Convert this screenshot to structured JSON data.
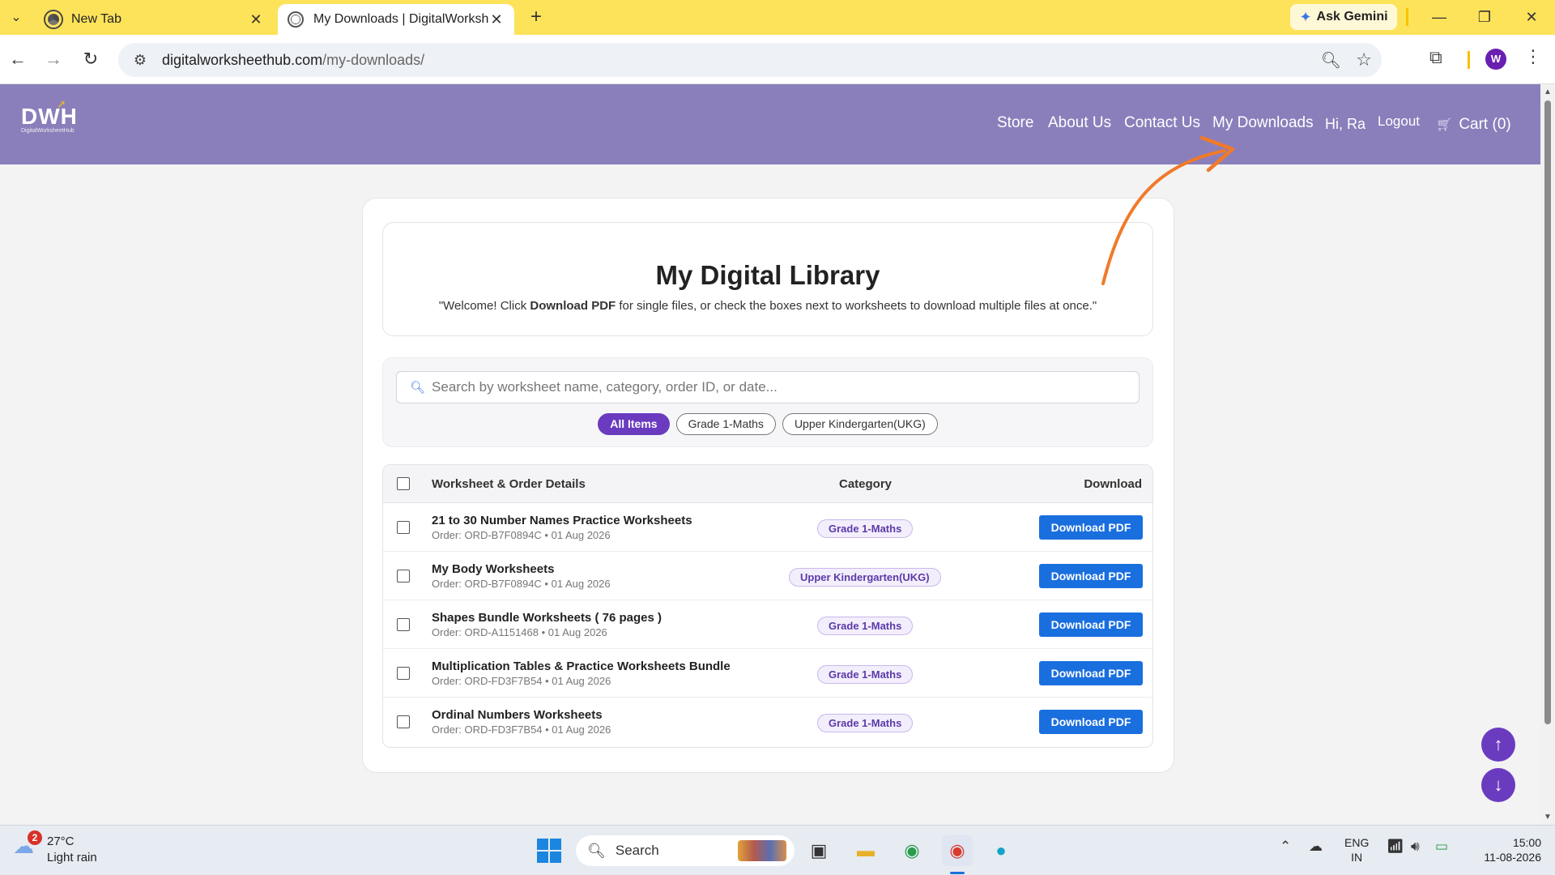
{
  "browser": {
    "tabs": [
      {
        "title": "New Tab",
        "active": false
      },
      {
        "title": "My Downloads | DigitalWorkshe",
        "active": true
      }
    ],
    "ask_gemini": "Ask Gemini",
    "url_domain": "digitalworksheethub.com",
    "url_path": "/my-downloads/",
    "profile_initial": "W"
  },
  "site": {
    "logo": "DWH",
    "logo_sub": "DigitalWorksheetHub",
    "nav": {
      "store": "Store",
      "about": "About Us",
      "contact": "Contact Us",
      "downloads": "My Downloads",
      "greeting": "Hi, Ra",
      "logout": "Logout",
      "cart": "Cart (0)"
    }
  },
  "library": {
    "title": "My Digital Library",
    "welcome_before": "\"Welcome! Click ",
    "welcome_bold": "Download PDF",
    "welcome_after": " for single files, or check the boxes next to worksheets to download multiple files at once.\"",
    "search_placeholder": "Search by worksheet name, category, order ID, or date...",
    "filters": [
      "All Items",
      "Grade 1-Maths",
      "Upper Kindergarten(UKG)"
    ],
    "active_filter": "All Items",
    "columns": {
      "details": "Worksheet & Order Details",
      "category": "Category",
      "download": "Download"
    },
    "download_label": "Download PDF",
    "rows": [
      {
        "name": "21 to 30 Number Names Practice Worksheets",
        "order": "Order: ORD-B7F0894C • 01 Aug 2026",
        "category": "Grade 1-Maths"
      },
      {
        "name": "My Body Worksheets",
        "order": "Order: ORD-B7F0894C • 01 Aug 2026",
        "category": "Upper Kindergarten(UKG)"
      },
      {
        "name": "Shapes Bundle Worksheets ( 76 pages )",
        "order": "Order: ORD-A1151468 • 01 Aug 2026",
        "category": "Grade 1-Maths"
      },
      {
        "name": "Multiplication Tables & Practice Worksheets Bundle",
        "order": "Order: ORD-FD3F7B54 • 01 Aug 2026",
        "category": "Grade 1-Maths"
      },
      {
        "name": "Ordinal Numbers Worksheets",
        "order": "Order: ORD-FD3F7B54 • 01 Aug 2026",
        "category": "Grade 1-Maths"
      }
    ]
  },
  "taskbar": {
    "weather_temp": "27°C",
    "weather_desc": "Light rain",
    "weather_badge": "2",
    "search": "Search",
    "lang_top": "ENG",
    "lang_bottom": "IN",
    "time": "15:00",
    "date": "11-08-2026"
  },
  "colors": {
    "header": "#8a7fbb",
    "accent_purple": "#6b3bbf",
    "download_blue": "#1a6fdf",
    "tabstrip": "#fde35a",
    "annotation_arrow": "#f07a2a"
  }
}
